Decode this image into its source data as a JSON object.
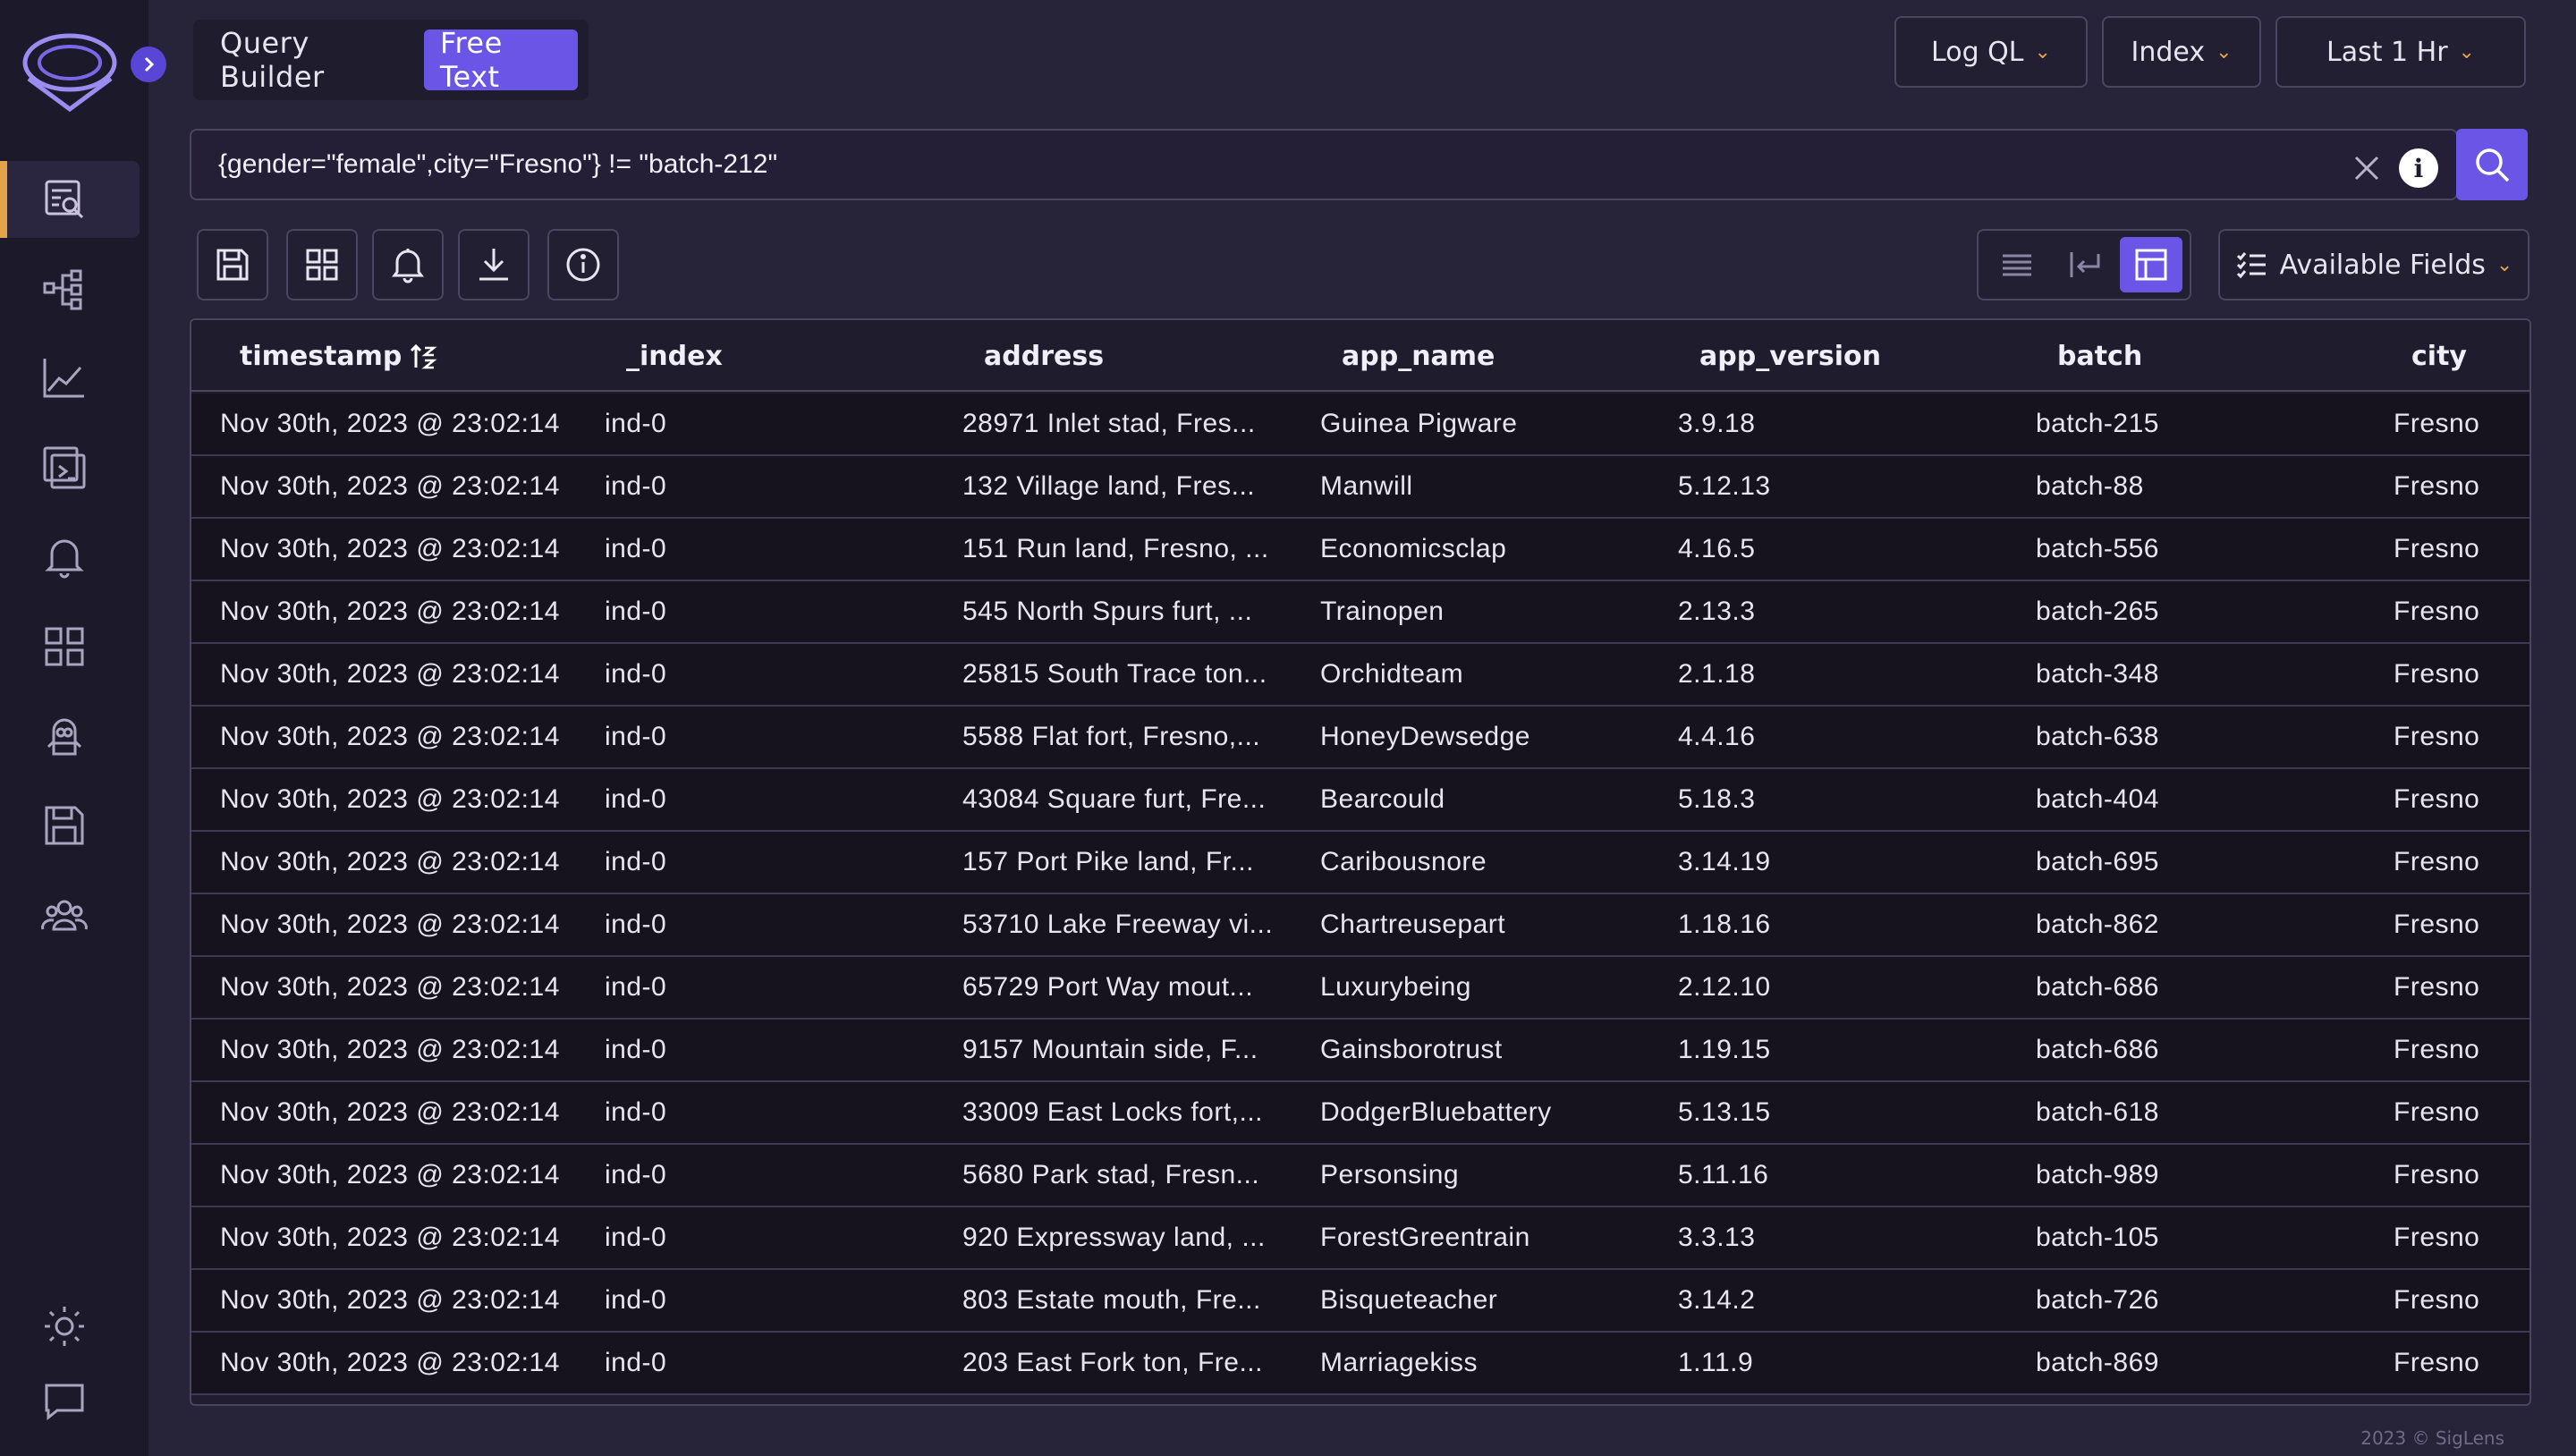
{
  "header": {
    "mode_tabs": [
      {
        "label": "Query Builder",
        "active": false
      },
      {
        "label": "Free Text",
        "active": true
      }
    ],
    "query_language": "Log QL",
    "index_label": "Index",
    "time_range": "Last 1 Hr"
  },
  "search": {
    "value": "{gender=\"female\",city=\"Fresno\"} != \"batch-212\""
  },
  "toolbar": {
    "available_fields_label": "Available Fields"
  },
  "table": {
    "columns": [
      "timestamp",
      "_index",
      "address",
      "app_name",
      "app_version",
      "batch",
      "city"
    ],
    "rows": [
      [
        "Nov 30th, 2023 @ 23:02:14",
        "ind-0",
        "28971 Inlet stad, Fres...",
        "Guinea Pigware",
        "3.9.18",
        "batch-215",
        "Fresno"
      ],
      [
        "Nov 30th, 2023 @ 23:02:14",
        "ind-0",
        "132 Village land, Fres...",
        "Manwill",
        "5.12.13",
        "batch-88",
        "Fresno"
      ],
      [
        "Nov 30th, 2023 @ 23:02:14",
        "ind-0",
        "151 Run land, Fresno, ...",
        "Economicsclap",
        "4.16.5",
        "batch-556",
        "Fresno"
      ],
      [
        "Nov 30th, 2023 @ 23:02:14",
        "ind-0",
        "545 North Spurs furt, ...",
        "Trainopen",
        "2.13.3",
        "batch-265",
        "Fresno"
      ],
      [
        "Nov 30th, 2023 @ 23:02:14",
        "ind-0",
        "25815 South Trace ton...",
        "Orchidteam",
        "2.1.18",
        "batch-348",
        "Fresno"
      ],
      [
        "Nov 30th, 2023 @ 23:02:14",
        "ind-0",
        "5588 Flat fort, Fresno,...",
        "HoneyDewsedge",
        "4.4.16",
        "batch-638",
        "Fresno"
      ],
      [
        "Nov 30th, 2023 @ 23:02:14",
        "ind-0",
        "43084 Square furt, Fre...",
        "Bearcould",
        "5.18.3",
        "batch-404",
        "Fresno"
      ],
      [
        "Nov 30th, 2023 @ 23:02:14",
        "ind-0",
        "157 Port Pike land, Fr...",
        "Caribousnore",
        "3.14.19",
        "batch-695",
        "Fresno"
      ],
      [
        "Nov 30th, 2023 @ 23:02:14",
        "ind-0",
        "53710 Lake Freeway vi...",
        "Chartreusepart",
        "1.18.16",
        "batch-862",
        "Fresno"
      ],
      [
        "Nov 30th, 2023 @ 23:02:14",
        "ind-0",
        "65729 Port Way mout...",
        "Luxurybeing",
        "2.12.10",
        "batch-686",
        "Fresno"
      ],
      [
        "Nov 30th, 2023 @ 23:02:14",
        "ind-0",
        "9157 Mountain side, F...",
        "Gainsborotrust",
        "1.19.15",
        "batch-686",
        "Fresno"
      ],
      [
        "Nov 30th, 2023 @ 23:02:14",
        "ind-0",
        "33009 East Locks fort,...",
        "DodgerBluebattery",
        "5.13.15",
        "batch-618",
        "Fresno"
      ],
      [
        "Nov 30th, 2023 @ 23:02:14",
        "ind-0",
        "5680 Park stad, Fresn...",
        "Personsing",
        "5.11.16",
        "batch-989",
        "Fresno"
      ],
      [
        "Nov 30th, 2023 @ 23:02:14",
        "ind-0",
        "920 Expressway land, ...",
        "ForestGreentrain",
        "3.3.13",
        "batch-105",
        "Fresno"
      ],
      [
        "Nov 30th, 2023 @ 23:02:14",
        "ind-0",
        "803 Estate mouth, Fre...",
        "Bisqueteacher",
        "3.14.2",
        "batch-726",
        "Fresno"
      ],
      [
        "Nov 30th, 2023 @ 23:02:14",
        "ind-0",
        "203 East Fork ton, Fre...",
        "Marriagekiss",
        "1.11.9",
        "batch-869",
        "Fresno"
      ]
    ]
  },
  "footer": {
    "text": "2023 © SigLens"
  },
  "colors": {
    "accent": "#6a55e6",
    "highlight": "#e3a34b",
    "background": "#272339"
  }
}
